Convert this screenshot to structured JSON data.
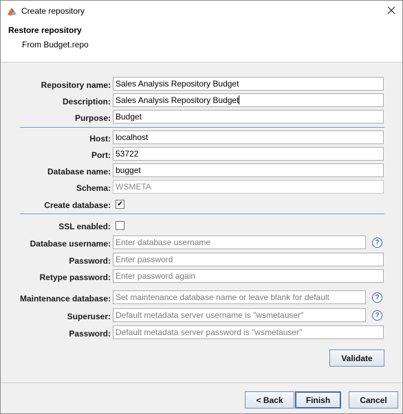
{
  "window": {
    "title": "Create repository"
  },
  "header": {
    "title": "Restore repository",
    "subtitle": "From Budget.repo"
  },
  "form": {
    "repository_name": {
      "label": "Repository name:",
      "value": "Sales Analysis Repository Budget"
    },
    "description": {
      "label": "Description:",
      "value": "Sales Analysis Repository Budget"
    },
    "purpose": {
      "label": "Purpose:",
      "value": "Budget"
    },
    "host": {
      "label": "Host:",
      "value": "localhost"
    },
    "port": {
      "label": "Port:",
      "value": "53722"
    },
    "database_name": {
      "label": "Database name:",
      "value": "bugget"
    },
    "schema": {
      "label": "Schema:",
      "value": "WSMETA"
    },
    "create_database": {
      "label": "Create database:",
      "checked": true
    },
    "ssl_enabled": {
      "label": "SSL enabled:",
      "checked": false
    },
    "db_username": {
      "label": "Database username:",
      "placeholder": "Enter database username"
    },
    "password": {
      "label": "Password:",
      "placeholder": "Enter password"
    },
    "retype_password": {
      "label": "Retype password:",
      "placeholder": "Enter password again"
    },
    "maintenance_db": {
      "label": "Maintenance database:",
      "placeholder": "Set maintenance database name or leave blank for default"
    },
    "superuser": {
      "label": "Superuser:",
      "placeholder": "Default metadata server username is \"wsmetauser\""
    },
    "superuser_password": {
      "label": "Password:",
      "placeholder": "Default metadata server password is \"wsmetauser\""
    }
  },
  "buttons": {
    "validate": "Validate",
    "back": "< Back",
    "finish": "Finish",
    "cancel": "Cancel"
  },
  "icons": {
    "help": "?",
    "check": "✔",
    "close": "✕"
  },
  "colors": {
    "separator": "#7b96c4",
    "help_icon": "#2f5fb3",
    "default_button_border": "#3d6db5"
  }
}
